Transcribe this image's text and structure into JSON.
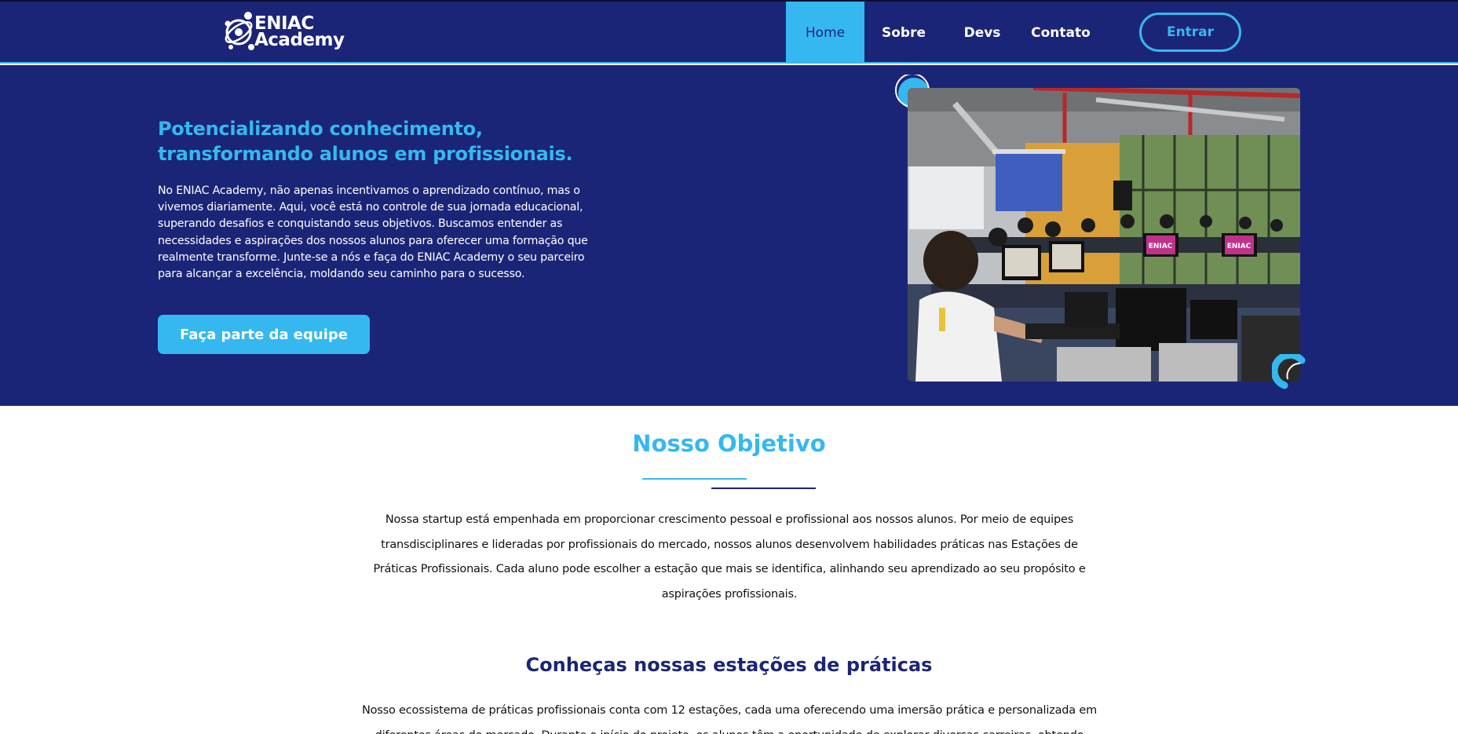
{
  "navbar": {
    "logo_line1": "ENIAC",
    "logo_line2": "Academy",
    "items": [
      {
        "label": "Home",
        "active": true
      },
      {
        "label": "Sobre"
      },
      {
        "label": "Devs"
      },
      {
        "label": "Contato"
      }
    ],
    "login_label": "Entrar"
  },
  "hero": {
    "title_line1": "Potencializando conhecimento,",
    "title_line2": "transformando alunos em profissionais.",
    "text": "No ENIAC Academy, não apenas incentivamos o aprendizado contínuo, mas o vivemos diariamente. Aqui, você está no controle de sua jornada educacional, superando desafios e conquistando seus objetivos. Buscamos entender as necessidades e aspirações dos nossos alunos para oferecer uma formação que realmente transforme. Junte-se a nós e faça do ENIAC Academy o seu parceiro para alcançar a excelência, moldando seu caminho para o sucesso.",
    "cta_label": "Faça parte da equipe",
    "photo_screen_label": "ENIAC"
  },
  "objective": {
    "title": "Nosso Objetivo",
    "text": "Nossa startup está empenhada em proporcionar crescimento pessoal e profissional aos nossos alunos. Por meio de equipes transdisciplinares e lideradas por profissionais do mercado, nossos alunos desenvolvem habilidades práticas nas Estações de Práticas Profissionais. Cada aluno pode escolher a estação que mais se identifica, alinhando seu aprendizado ao seu propósito e aspirações profissionais."
  },
  "stations": {
    "title": "Conheças nossas estações de práticas",
    "text": "Nosso ecossistema de práticas profissionais conta com 12 estações, cada uma oferecendo uma imersão prática e personalizada em diferentes áreas do mercado. Durante o início do projeto, os alunos têm a oportunidade de explorar diversas carreiras, obtendo"
  },
  "colors": {
    "navy": "#1b2577",
    "accent": "#35b8f0",
    "text": "#111111"
  }
}
